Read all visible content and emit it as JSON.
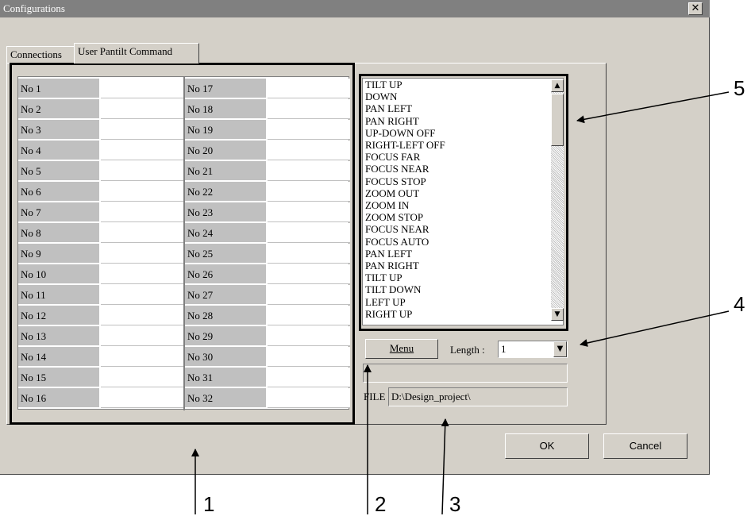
{
  "window": {
    "title": "Configurations",
    "close_glyph": "✕"
  },
  "tabs": [
    {
      "label": "Connections",
      "active": false
    },
    {
      "label": "User Pantilt Command",
      "active": true
    }
  ],
  "commands_left": [
    "No 1",
    "No 2",
    "No 3",
    "No 4",
    "No 5",
    "No 6",
    "No 7",
    "No 8",
    "No 9",
    "No 10",
    "No 11",
    "No 12",
    "No 13",
    "No 14",
    "No 15",
    "No 16"
  ],
  "commands_right": [
    "No 17",
    "No 18",
    "No 19",
    "No 20",
    "No 21",
    "No 22",
    "No 23",
    "No 24",
    "No 25",
    "No 26",
    "No 27",
    "No 28",
    "No 29",
    "No 30",
    "No 31",
    "No 32"
  ],
  "command_list": [
    "TILT UP",
    "DOWN",
    "PAN LEFT",
    "PAN RIGHT",
    "UP-DOWN OFF",
    "RIGHT-LEFT OFF",
    "FOCUS FAR",
    "FOCUS NEAR",
    "FOCUS STOP",
    "ZOOM OUT",
    "ZOOM IN",
    "ZOOM STOP",
    "FOCUS NEAR",
    "FOCUS AUTO",
    "PAN LEFT",
    "PAN RIGHT",
    "TILT UP",
    "TILT DOWN",
    "LEFT UP",
    "RIGHT UP"
  ],
  "controls": {
    "menu_label": "Menu",
    "length_label": "Length :",
    "length_value": "1",
    "file_label": "FILE",
    "file_path": "D:\\Design_project\\"
  },
  "buttons": {
    "ok": "OK",
    "cancel": "Cancel"
  },
  "callouts": {
    "c1": "1",
    "c2": "2",
    "c3": "3",
    "c4": "4",
    "c5": "5"
  },
  "icons": {
    "scroll_up": "▲",
    "scroll_down": "▼",
    "dropdown": "▼",
    "callout_arrow": "arrow-callout"
  }
}
